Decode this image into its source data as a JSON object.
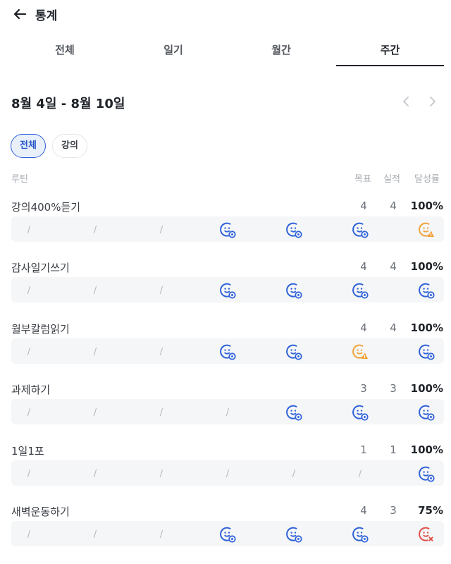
{
  "header": {
    "title": "통계",
    "back_icon": "arrow-left-icon"
  },
  "tabs": [
    {
      "label": "전체",
      "active": false
    },
    {
      "label": "일기",
      "active": false
    },
    {
      "label": "월간",
      "active": false
    },
    {
      "label": "주간",
      "active": true
    }
  ],
  "week": {
    "range": "8월 4일 - 8월 10일",
    "prev_icon": "chevron-left-icon",
    "next_icon": "chevron-right-icon"
  },
  "filters": [
    {
      "label": "전체",
      "selected": true
    },
    {
      "label": "강의",
      "selected": false
    }
  ],
  "columns": {
    "routine": "루틴",
    "goal": "목표",
    "actual": "실적",
    "rate": "달성률"
  },
  "colors": {
    "done": "#2f63d8",
    "warning": "#f0a33a",
    "missed": "#e0524a",
    "slash": "#b4b8be",
    "accent": "#2858c9"
  },
  "day_marks": {
    "slash": "/"
  },
  "routines": [
    {
      "name": "강의400%듣기",
      "goal": "4",
      "actual": "4",
      "rate": "100%",
      "days": [
        "none",
        "none",
        "none",
        "done",
        "done",
        "done",
        "warning"
      ]
    },
    {
      "name": "감사일기쓰기",
      "goal": "4",
      "actual": "4",
      "rate": "100%",
      "days": [
        "none",
        "none",
        "none",
        "done",
        "done",
        "done",
        "done"
      ]
    },
    {
      "name": "월부칼럼읽기",
      "goal": "4",
      "actual": "4",
      "rate": "100%",
      "days": [
        "none",
        "none",
        "none",
        "done",
        "done",
        "warning",
        "done"
      ]
    },
    {
      "name": "과제하기",
      "goal": "3",
      "actual": "3",
      "rate": "100%",
      "days": [
        "none",
        "none",
        "none",
        "none",
        "done",
        "done",
        "done"
      ]
    },
    {
      "name": "1일1포",
      "goal": "1",
      "actual": "1",
      "rate": "100%",
      "days": [
        "none",
        "none",
        "none",
        "none",
        "none",
        "none",
        "done"
      ]
    },
    {
      "name": "새벽운동하기",
      "goal": "4",
      "actual": "3",
      "rate": "75%",
      "days": [
        "none",
        "none",
        "none",
        "done",
        "done",
        "done",
        "missed"
      ]
    }
  ]
}
